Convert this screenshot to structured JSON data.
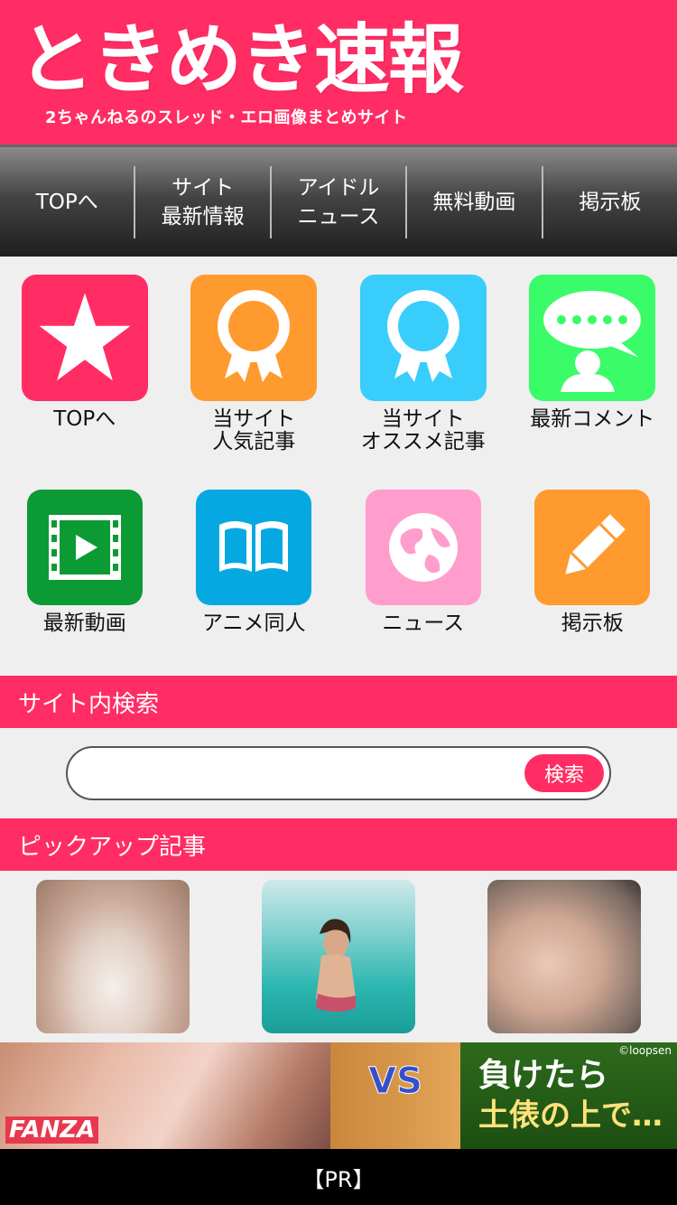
{
  "header": {
    "logo": "ときめき速報",
    "subtitle": "2ちゃんねるのスレッド・エロ画像まとめサイト"
  },
  "nav": [
    {
      "label": "TOPへ"
    },
    {
      "label": "サイト\n最新情報"
    },
    {
      "label": "アイドル\nニュース"
    },
    {
      "label": "無料動画"
    },
    {
      "label": "掲示板"
    }
  ],
  "icons": [
    {
      "label": "TOPへ",
      "icon": "star-icon",
      "color": "#ff2d63"
    },
    {
      "label": "当サイト\n人気記事",
      "icon": "award-icon",
      "color": "#ff9a2e"
    },
    {
      "label": "当サイト\nオススメ記事",
      "icon": "ribbon-icon",
      "color": "#39cdfc"
    },
    {
      "label": "最新コメント",
      "icon": "comment-icon",
      "color": "#3afb68"
    },
    {
      "label": "最新動画",
      "icon": "film-icon",
      "color": "#0c9a34"
    },
    {
      "label": "アニメ同人",
      "icon": "book-icon",
      "color": "#06a8e1"
    },
    {
      "label": "ニュース",
      "icon": "globe-icon",
      "color": "#ff9dcc"
    },
    {
      "label": "掲示板",
      "icon": "pencil-icon",
      "color": "#ff9a2e"
    }
  ],
  "search": {
    "title": "サイト内検索",
    "placeholder": "",
    "button_label": "検索"
  },
  "pickup": {
    "title": "ピックアップ記事"
  },
  "ad": {
    "brand": "FANZA",
    "vs_text": "VS",
    "copy": "©loopsen",
    "line1": "負けたら",
    "line2": "土俵の上で…"
  },
  "pr_label": "【PR】"
}
